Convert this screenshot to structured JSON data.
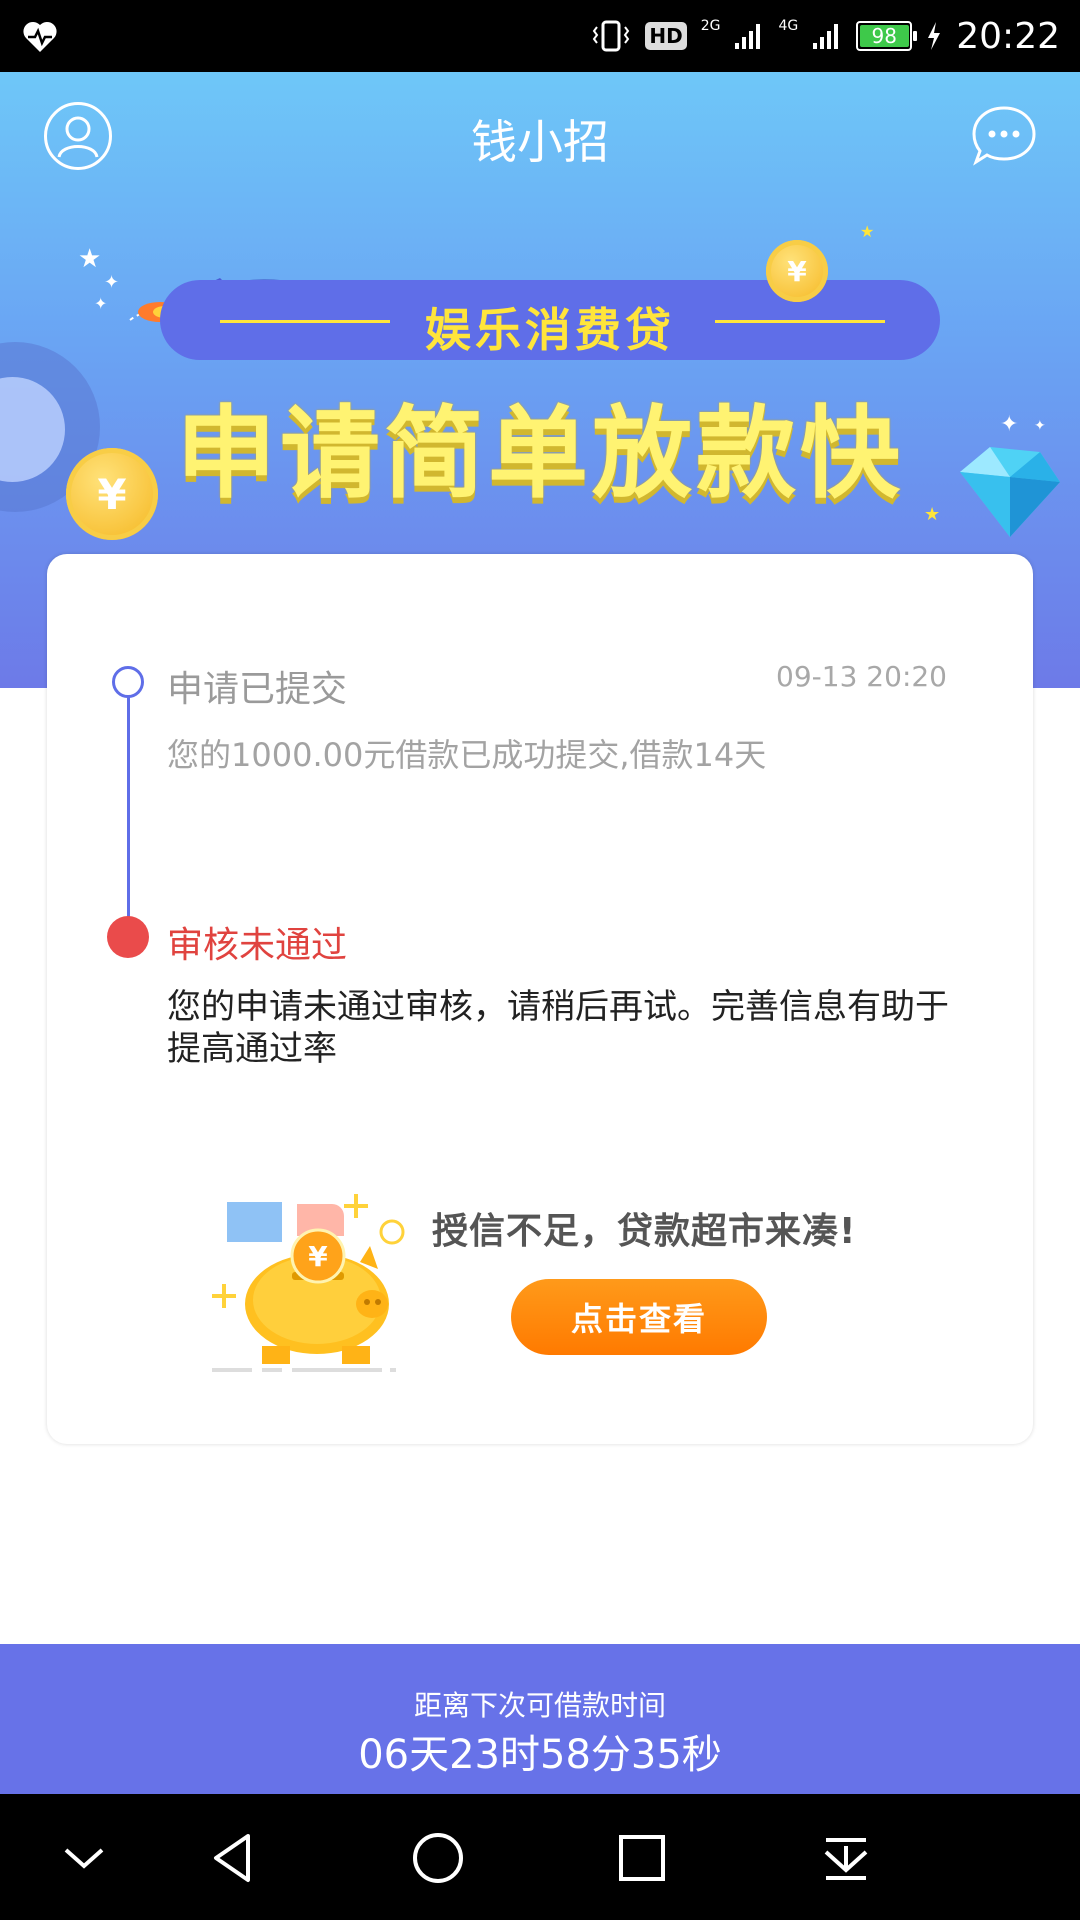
{
  "status_bar": {
    "time": "20:22",
    "battery": "98",
    "hd_label": "HD",
    "net_2g": "2G",
    "net_4g": "4G",
    "icons": [
      "heart-monitor-icon",
      "vibrate-icon",
      "hd-icon",
      "signal-icon",
      "battery-icon",
      "charging-icon"
    ]
  },
  "header": {
    "title": "钱小招",
    "left_icon": "user-icon",
    "right_icon": "chat-icon"
  },
  "banner": {
    "ribbon_text": "娱乐消费贷",
    "headline": "申请简单放款快",
    "coin_symbol": "¥"
  },
  "timeline": {
    "step1": {
      "title": "申请已提交",
      "time": "09-13 20:20",
      "desc": "您的1000.00元借款已成功提交,借款14天"
    },
    "step2": {
      "title": "审核未通过",
      "desc": "您的申请未通过审核，请稍后再试。完善信息有助于提高通过率"
    }
  },
  "promo": {
    "text": "授信不足，贷款超市来凑!",
    "button": "点击查看",
    "coin_symbol": "¥"
  },
  "countdown": {
    "label": "距离下次可借款时间",
    "value": "06天23时58分35秒"
  },
  "nav": [
    "chevron-down-icon",
    "back-icon",
    "home-icon",
    "recents-icon",
    "notification-pull-icon"
  ],
  "colors": {
    "primary": "#6772e8",
    "accent_yellow": "#fff372",
    "error": "#e0433f",
    "button_orange": "#ff7a00"
  }
}
